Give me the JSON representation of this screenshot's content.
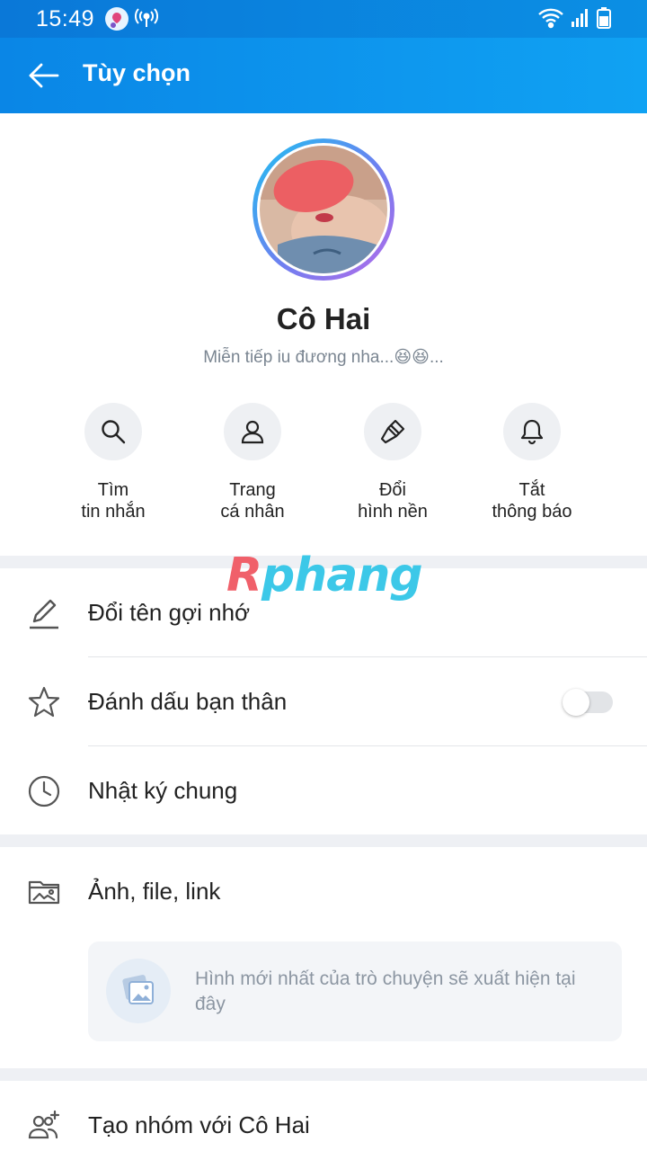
{
  "status_bar": {
    "time": "15:49"
  },
  "header": {
    "title": "Tùy chọn"
  },
  "profile": {
    "name": "Cô Hai",
    "status": "Miễn tiếp iu đương nha...😆😆..."
  },
  "actions": [
    {
      "label_line1": "Tìm",
      "label_line2": "tin nhắn",
      "icon": "search-icon"
    },
    {
      "label_line1": "Trang",
      "label_line2": "cá nhân",
      "icon": "person-icon"
    },
    {
      "label_line1": "Đổi",
      "label_line2": "hình nền",
      "icon": "paint-brush-icon"
    },
    {
      "label_line1": "Tắt",
      "label_line2": "thông báo",
      "icon": "bell-icon"
    }
  ],
  "watermark": {
    "first": "R",
    "rest": "phang"
  },
  "menu": {
    "rename": "Đổi tên gợi nhớ",
    "best_friend": "Đánh dấu bạn thân",
    "best_friend_on": false,
    "journal": "Nhật ký chung",
    "media": "Ảnh, file, link",
    "media_empty": "Hình mới nhất của trò chuyện sẽ xuất hiện tại đây",
    "create_group": "Tạo nhóm với Cô Hai"
  }
}
